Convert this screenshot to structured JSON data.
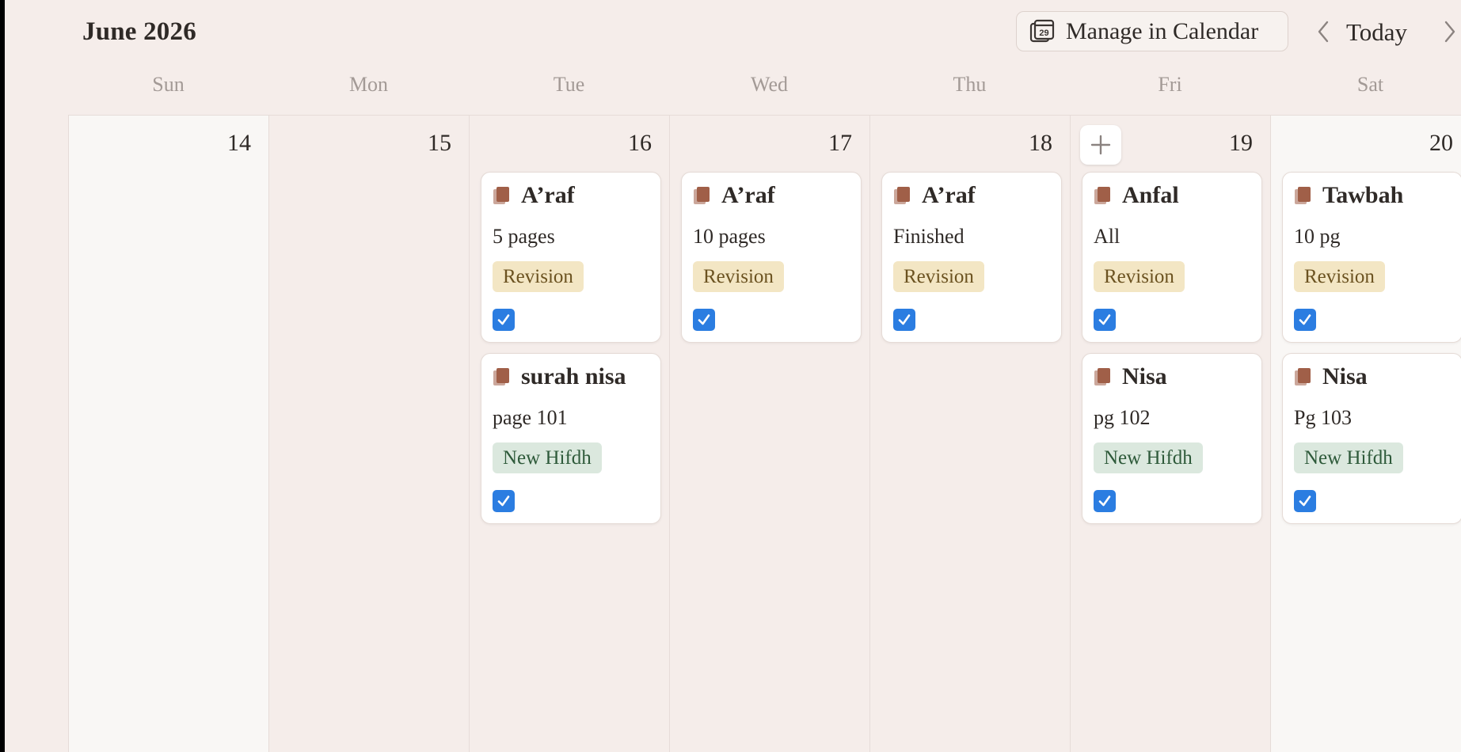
{
  "header": {
    "title": "June 2026",
    "manage_label": "Manage in Calendar",
    "calendar_icon_number": "29",
    "today_label": "Today"
  },
  "weekdays": [
    "Sun",
    "Mon",
    "Tue",
    "Wed",
    "Thu",
    "Fri",
    "Sat"
  ],
  "days": [
    {
      "num": "14",
      "weekend": true,
      "events": []
    },
    {
      "num": "15",
      "weekend": false,
      "events": []
    },
    {
      "num": "16",
      "weekend": false,
      "events": [
        {
          "title": "A’raf",
          "sub": "5 pages",
          "tag": "Revision",
          "tag_type": "revision",
          "checked": true
        },
        {
          "title": "surah nisa",
          "sub": "page 101",
          "tag": "New Hifdh",
          "tag_type": "new",
          "checked": true
        }
      ]
    },
    {
      "num": "17",
      "weekend": false,
      "events": [
        {
          "title": "A’raf",
          "sub": "10 pages",
          "tag": "Revision",
          "tag_type": "revision",
          "checked": true
        }
      ]
    },
    {
      "num": "18",
      "weekend": false,
      "events": [
        {
          "title": "A’raf",
          "sub": "Finished",
          "tag": "Revision",
          "tag_type": "revision",
          "checked": true
        }
      ]
    },
    {
      "num": "19",
      "weekend": false,
      "show_add": true,
      "events": [
        {
          "title": "Anfal",
          "sub": "All",
          "tag": "Revision",
          "tag_type": "revision",
          "checked": true
        },
        {
          "title": "Nisa",
          "sub": "pg 102",
          "tag": "New Hifdh",
          "tag_type": "new",
          "checked": true
        }
      ]
    },
    {
      "num": "20",
      "weekend": true,
      "events": [
        {
          "title": "Tawbah",
          "sub": "10 pg",
          "tag": "Revision",
          "tag_type": "revision",
          "checked": true
        },
        {
          "title": "Nisa",
          "sub": "Pg 103",
          "tag": "New Hifdh",
          "tag_type": "new",
          "checked": true
        }
      ]
    }
  ],
  "colors": {
    "revision_bg": "#f3e6c4",
    "revision_text": "#6b5220",
    "new_bg": "#dbe8de",
    "new_text": "#2e5a3a",
    "checkbox": "#2b7de1",
    "book_icon": "#a05f48"
  }
}
